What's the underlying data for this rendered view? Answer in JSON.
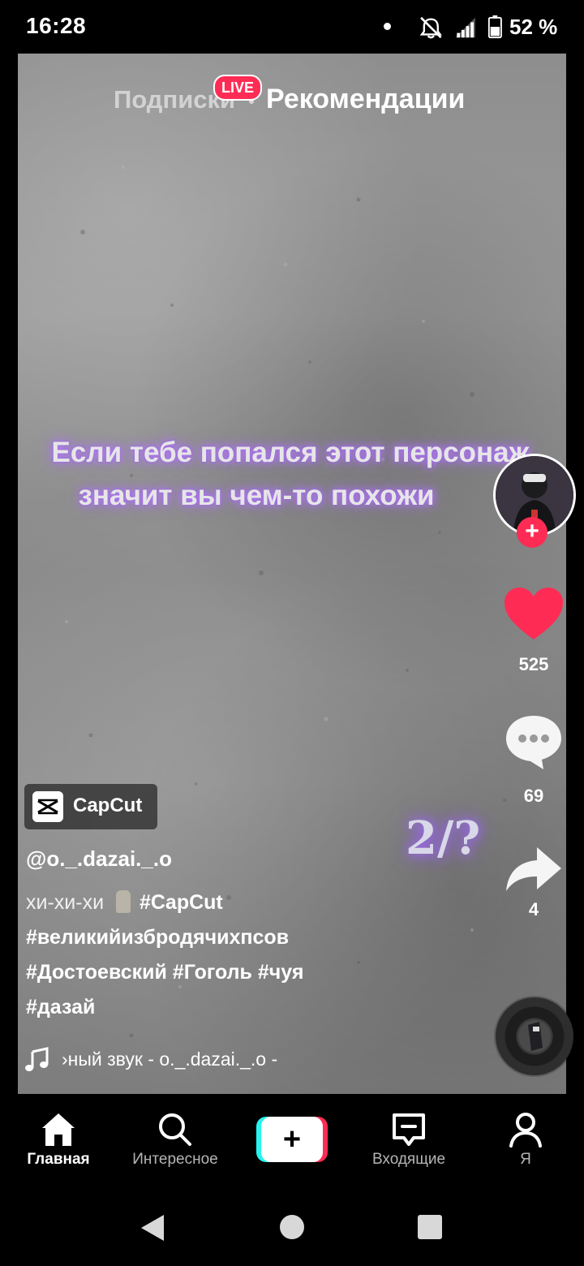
{
  "status_bar": {
    "time": "16:28",
    "battery_percent": "52 %",
    "icons": [
      "dot",
      "silent-bell-icon",
      "signal-icon",
      "battery-icon"
    ]
  },
  "top_tabs": {
    "following": "Подписки",
    "live": "LIVE",
    "for_you": "Рекомендации"
  },
  "video": {
    "caption_line1": "Если тебе попался этот персонаж",
    "caption_line2": "значит вы чем-то похожи",
    "counter": "2/?"
  },
  "actions": {
    "likes": "525",
    "comments": "69",
    "shares": "4",
    "follow_symbol": "+"
  },
  "post": {
    "badge": "CapCut",
    "username": "@o._.dazai._.o",
    "desc_prefix": "хи-хи-хи",
    "desc_tag1": "#CapCut",
    "desc_line2": "#великийизбродячихпсов",
    "desc_line3": "#Достоевский #Гоголь #чуя",
    "desc_line4": "#дазай",
    "sound": "›ный звук - o._.dazai._.o -"
  },
  "bottom_nav": {
    "home": "Главная",
    "discover": "Интересное",
    "create": "+",
    "inbox": "Входящие",
    "profile": "Я"
  },
  "colors": {
    "like": "#fe2c55",
    "accent_cyan": "#25f4ee",
    "caption_glow": "#a56af5"
  }
}
